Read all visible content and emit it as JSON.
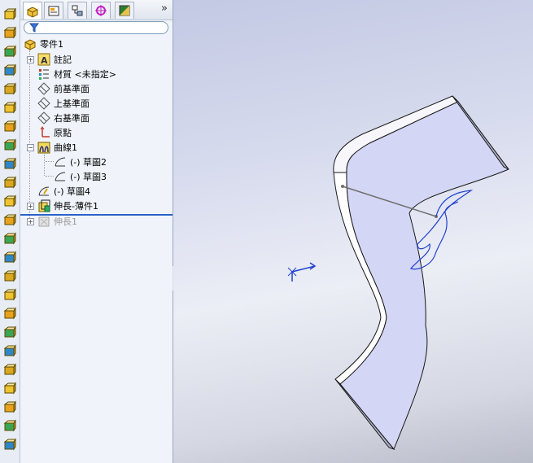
{
  "feature_manager": {
    "tabs": [
      "FeatureManager",
      "PropertyManager",
      "ConfigurationManager",
      "DimXpertManager",
      "DisplayManager"
    ],
    "more_label": "»",
    "filter_placeholder": "",
    "tree": {
      "root": "零件1",
      "annotations": "註記",
      "material": "材質 <未指定>",
      "front_plane": "前基準面",
      "top_plane": "上基準面",
      "right_plane": "右基準面",
      "origin": "原點",
      "curve": "曲線1",
      "sketch2": "(-) 草圖2",
      "sketch3": "(-) 草圖3",
      "sketch4": "(-) 草圖4",
      "extrude_thin": "伸長-薄件1",
      "extrude": "伸長1"
    }
  },
  "colors": {
    "accent": "#2a62c8",
    "part_face": "#d3d6f4",
    "part_edge": "#1a1a1a",
    "sketch_curve": "#1f3fd0"
  },
  "icons": {
    "command_bar": [
      "extruded-boss-icon",
      "revolved-boss-icon",
      "swept-boss-icon",
      "lofted-boss-icon",
      "boundary-boss-icon",
      "extruded-cut-icon",
      "revolved-cut-icon",
      "swept-cut-icon",
      "lofted-cut-icon",
      "boundary-cut-icon",
      "fillet-icon",
      "chamfer-icon",
      "rib-icon",
      "shell-icon",
      "draft-icon",
      "wrap-icon",
      "dome-icon",
      "intersect-icon",
      "mirror-icon",
      "pattern-icon",
      "reference-geometry-icon",
      "curves-icon",
      "instant3d-icon",
      "hole-wizard-icon"
    ]
  }
}
